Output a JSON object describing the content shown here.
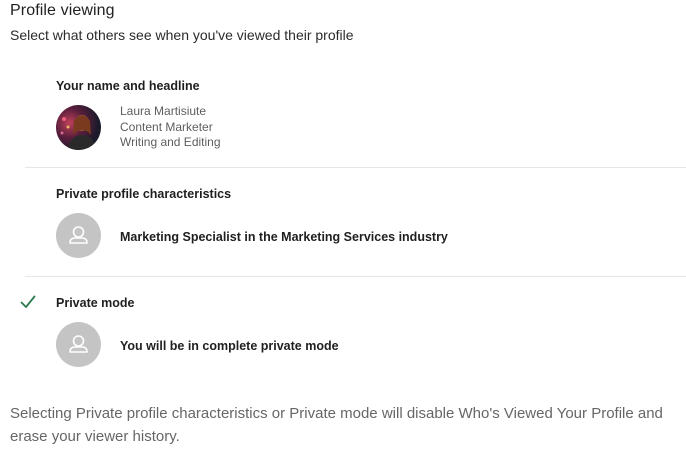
{
  "header": {
    "title": "Profile viewing",
    "subtitle": "Select what others see when you've viewed their profile"
  },
  "options": [
    {
      "title": "Your name and headline",
      "selected": false,
      "avatar": "profile-photo",
      "lines": [
        "Laura Martisiute",
        "Content Marketer",
        "Writing and Editing"
      ]
    },
    {
      "title": "Private profile characteristics",
      "selected": false,
      "avatar": "person-placeholder-icon",
      "detail": "Marketing Specialist in the Marketing Services industry"
    },
    {
      "title": "Private mode",
      "selected": true,
      "avatar": "person-placeholder-icon",
      "detail": "You will be in complete private mode"
    }
  ],
  "footer": {
    "note": "Selecting Private profile characteristics or Private mode will disable Who's Viewed Your Profile and erase your viewer history."
  },
  "colors": {
    "check": "#2e7d4f",
    "placeholder_bg": "#c4c4c4",
    "divider": "#e6e6e6"
  }
}
